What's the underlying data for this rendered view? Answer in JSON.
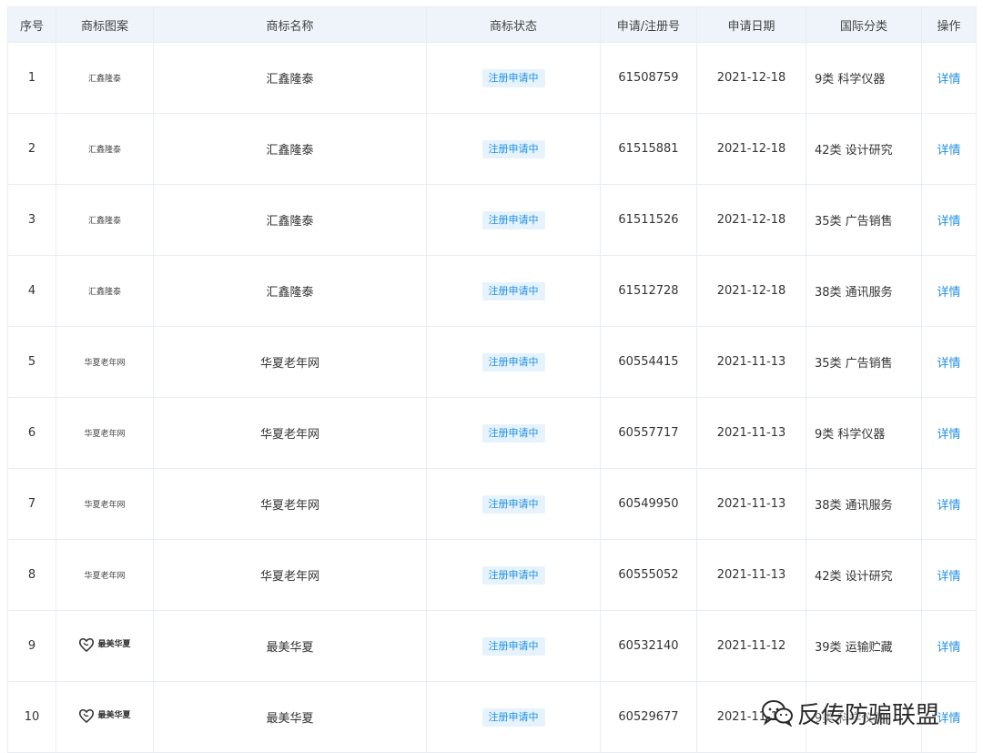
{
  "table": {
    "headers": [
      "序号",
      "商标图案",
      "商标名称",
      "商标状态",
      "申请/注册号",
      "申请日期",
      "国际分类",
      "操作"
    ],
    "rows": [
      {
        "index": "1",
        "logo_text": "汇鑫隆泰",
        "logo_type": "text",
        "name": "汇鑫隆泰",
        "status": "注册申请中",
        "reg_no": "61508759",
        "date": "2021-12-18",
        "class": "9类 科学仪器",
        "action": "详情"
      },
      {
        "index": "2",
        "logo_text": "汇鑫隆泰",
        "logo_type": "text",
        "name": "汇鑫隆泰",
        "status": "注册申请中",
        "reg_no": "61515881",
        "date": "2021-12-18",
        "class": "42类 设计研究",
        "action": "详情"
      },
      {
        "index": "3",
        "logo_text": "汇鑫隆泰",
        "logo_type": "text",
        "name": "汇鑫隆泰",
        "status": "注册申请中",
        "reg_no": "61511526",
        "date": "2021-12-18",
        "class": "35类 广告销售",
        "action": "详情"
      },
      {
        "index": "4",
        "logo_text": "汇鑫隆泰",
        "logo_type": "text",
        "name": "汇鑫隆泰",
        "status": "注册申请中",
        "reg_no": "61512728",
        "date": "2021-12-18",
        "class": "38类 通讯服务",
        "action": "详情"
      },
      {
        "index": "5",
        "logo_text": "华夏老年网",
        "logo_type": "text",
        "name": "华夏老年网",
        "status": "注册申请中",
        "reg_no": "60554415",
        "date": "2021-11-13",
        "class": "35类 广告销售",
        "action": "详情"
      },
      {
        "index": "6",
        "logo_text": "华夏老年网",
        "logo_type": "text",
        "name": "华夏老年网",
        "status": "注册申请中",
        "reg_no": "60557717",
        "date": "2021-11-13",
        "class": "9类 科学仪器",
        "action": "详情"
      },
      {
        "index": "7",
        "logo_text": "华夏老年网",
        "logo_type": "text",
        "name": "华夏老年网",
        "status": "注册申请中",
        "reg_no": "60549950",
        "date": "2021-11-13",
        "class": "38类 通讯服务",
        "action": "详情"
      },
      {
        "index": "8",
        "logo_text": "华夏老年网",
        "logo_type": "text",
        "name": "华夏老年网",
        "status": "注册申请中",
        "reg_no": "60555052",
        "date": "2021-11-13",
        "class": "42类 设计研究",
        "action": "详情"
      },
      {
        "index": "9",
        "logo_text": "最美华夏",
        "logo_type": "graphic",
        "name": "最美华夏",
        "status": "注册申请中",
        "reg_no": "60532140",
        "date": "2021-11-12",
        "class": "39类 运输贮藏",
        "action": "详情"
      },
      {
        "index": "10",
        "logo_text": "最美华夏",
        "logo_type": "graphic",
        "name": "最美华夏",
        "status": "注册申请中",
        "reg_no": "60529677",
        "date": "2021-11-12",
        "class": "9类 科学仪器",
        "action": "详情"
      }
    ]
  },
  "watermark": {
    "text": "反传防骗联盟",
    "icon": "wechat-icon"
  },
  "colors": {
    "header_bg": "#eef4fa",
    "border": "#e7edf3",
    "badge_bg": "#e6f3fd",
    "link": "#1e90e6"
  }
}
